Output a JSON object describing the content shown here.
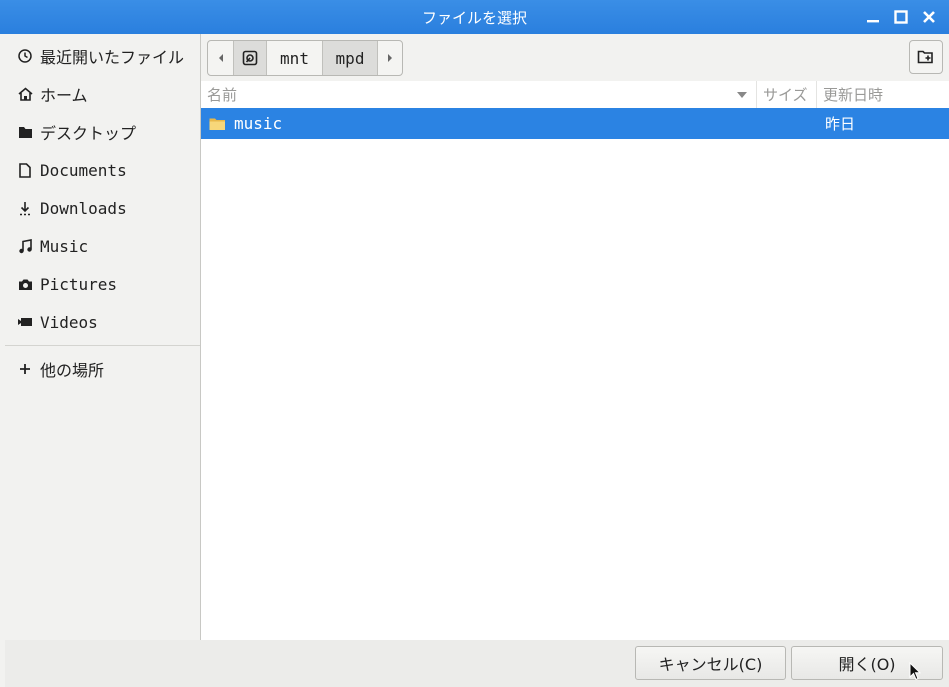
{
  "window": {
    "title": "ファイルを選択"
  },
  "sidebar": {
    "items": [
      {
        "label": "最近開いたファイル",
        "icon": "recent-clock-icon"
      },
      {
        "label": "ホーム",
        "icon": "home-icon"
      },
      {
        "label": "デスクトップ",
        "icon": "desktop-folder-icon"
      },
      {
        "label": "Documents",
        "icon": "document-icon"
      },
      {
        "label": "Downloads",
        "icon": "download-icon"
      },
      {
        "label": "Music",
        "icon": "music-note-icon"
      },
      {
        "label": "Pictures",
        "icon": "camera-icon"
      },
      {
        "label": "Videos",
        "icon": "video-camera-icon"
      }
    ],
    "other_locations": {
      "label": "他の場所",
      "icon": "plus-icon"
    }
  },
  "pathbar": {
    "segments": [
      "mnt",
      "mpd"
    ],
    "current": "mpd"
  },
  "columns": {
    "name": "名前",
    "size": "サイズ",
    "modified": "更新日時"
  },
  "files": [
    {
      "name": "music",
      "size": "",
      "modified": "昨日",
      "type": "folder",
      "selected": true
    }
  ],
  "buttons": {
    "cancel": "キャンセル(C)",
    "open": "開く(O)"
  },
  "colors": {
    "titlebar": "#2a7fde",
    "selection": "#2b83e3",
    "folder": "#f0c65a"
  }
}
